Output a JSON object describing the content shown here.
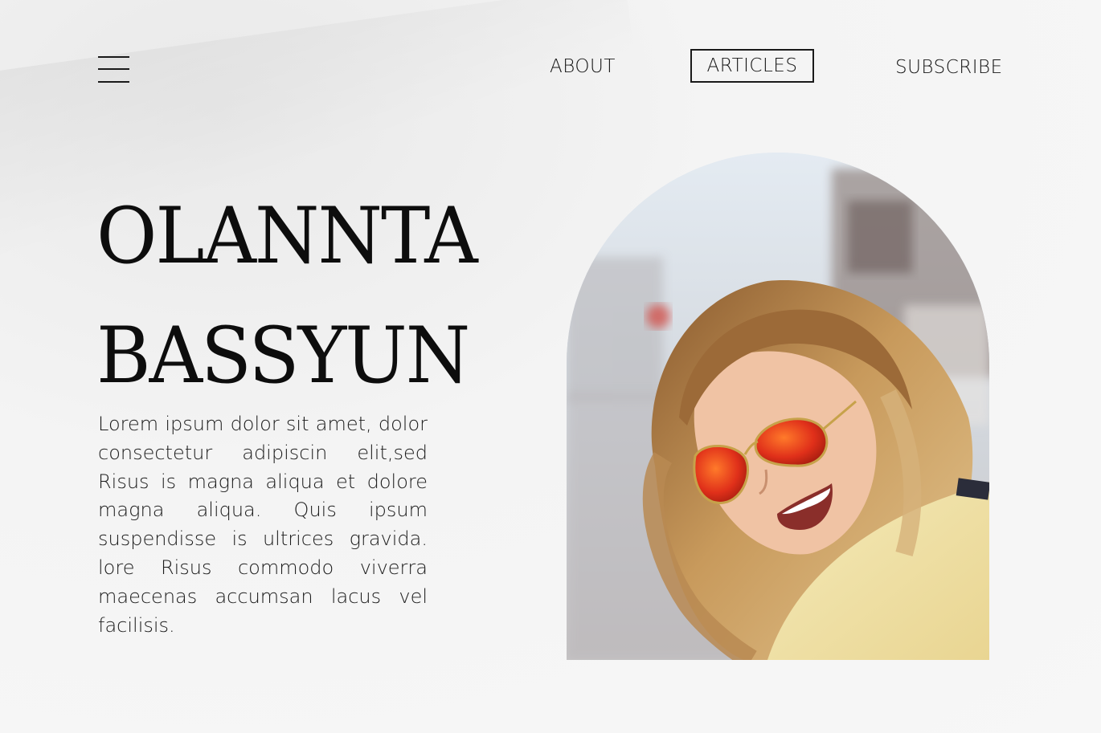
{
  "nav": {
    "about": "ABOUT",
    "articles": "ARTICLES",
    "subscribe": "SUBSCRIBE",
    "active": "articles"
  },
  "menu": {
    "icon": "hamburger-menu-icon"
  },
  "hero": {
    "title_line1": "OLANNTA",
    "title_line2": "BASSYUN",
    "body": "Lorem ipsum dolor sit amet, dolor consectetur adipiscin elit,sed Risus is magna aliqua et dolore magna aliqua. Quis ipsum suspendisse is ultrices gravida. lore Risus commodo viverra maecenas accumsan lacus vel facilisis."
  },
  "colors": {
    "background": "#f4f4f4",
    "text": "#111111",
    "border": "#1a1a1a"
  }
}
